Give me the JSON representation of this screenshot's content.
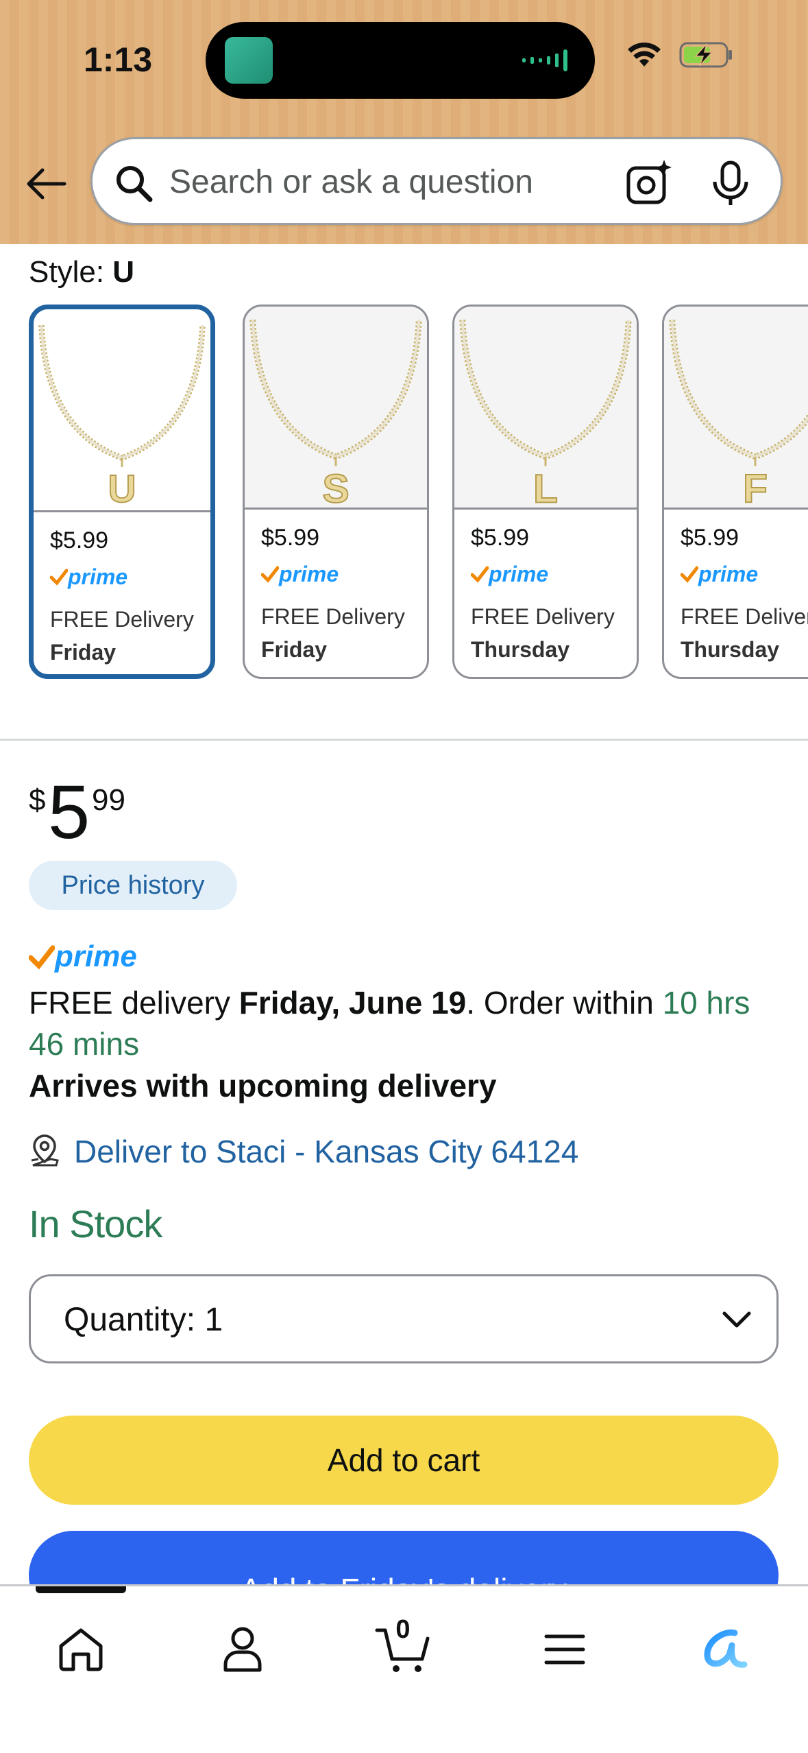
{
  "status_bar": {
    "time": "1:13"
  },
  "search": {
    "placeholder": "Search or ask a question"
  },
  "style_selector": {
    "label": "Style:",
    "selected_value": "U",
    "options": [
      {
        "letter": "U",
        "price": "$5.99",
        "delivery": "FREE Delivery",
        "day": "Friday",
        "selected": true
      },
      {
        "letter": "S",
        "price": "$5.99",
        "delivery": "FREE Delivery",
        "day": "Friday",
        "selected": false
      },
      {
        "letter": "L",
        "price": "$5.99",
        "delivery": "FREE Delivery",
        "day": "Thursday",
        "selected": false
      },
      {
        "letter": "F",
        "price": "$5.99",
        "delivery": "FREE Delivery",
        "day": "Thursday",
        "selected": false
      }
    ]
  },
  "prime": {
    "label": "prime"
  },
  "buy_box": {
    "price_symbol": "$",
    "price_whole": "5",
    "price_fraction": "99",
    "price_history_label": "Price history",
    "delivery_prefix": "FREE delivery",
    "delivery_date": "Friday, June 19",
    "order_within_label": ". Order within",
    "countdown": "10 hrs 46 mins",
    "arrives_label": "Arrives with upcoming delivery",
    "deliver_to": "Deliver to Staci - Kansas City 64124",
    "stock_status": "In Stock",
    "quantity_label": "Quantity:",
    "quantity_value": "1",
    "add_to_cart_label": "Add to cart",
    "add_to_delivery_label": "Add to Friday's delivery"
  },
  "bottom_nav": {
    "cart_count": "0",
    "items": [
      "home-icon",
      "account-icon",
      "cart-icon",
      "menu-icon",
      "alexa-icon"
    ]
  },
  "colors": {
    "header_bg": "#e2b47f",
    "link_blue": "#2162a1",
    "in_stock_green": "#2c7c55",
    "add_to_cart_yellow": "#f7d84a",
    "add_to_delivery_blue": "#2d64ef",
    "prime_blue": "#1a98ff",
    "prime_check_orange": "#f08804"
  }
}
